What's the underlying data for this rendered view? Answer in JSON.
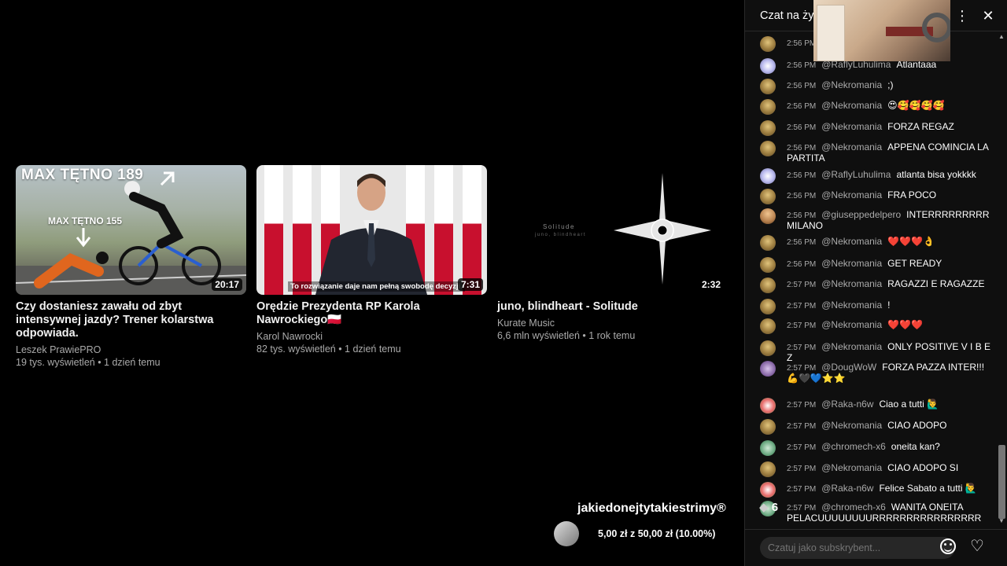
{
  "videos": [
    {
      "title": "Czy dostaniesz zawału od zbyt intensywnej jazdy? Trener kolarstwa odpowiada.",
      "channel": "Leszek PrawiePRO",
      "stats": "19 tys. wyświetleń • 1 dzień temu",
      "duration": "20:17",
      "thumb_text_big": "MAX TĘTNO 189",
      "thumb_text_small": "MAX TĘTNO 155"
    },
    {
      "title": "Orędzie Prezydenta RP Karola Nawrockiego🇵🇱",
      "channel": "Karol Nawrocki",
      "stats": "82 tys. wyświetleń • 1 dzień temu",
      "duration": "7:31",
      "thumb_caption": "To rozwiązanie daje nam pełną swobodę decyzji."
    },
    {
      "title": "juno, blindheart - Solitude",
      "channel": "Kurate Music",
      "stats": "6,6 mln wyświetleń • 1 rok temu",
      "duration": "2:32",
      "thumb_text": "Solitude",
      "thumb_subtext": "juno, blindheart"
    }
  ],
  "overlay": {
    "channel_name": "jakiedonejtytakiestrimy®",
    "progress_text": "5,00 zł z 50,00 zł (10.00%)",
    "badge_text": "6"
  },
  "chat": {
    "title": "Czat na żyw",
    "input_placeholder": "Czatuj jako subskrybent...",
    "messages": [
      {
        "time": "2:56 PM",
        "author": "",
        "text": "",
        "avatar": "nek"
      },
      {
        "time": "2:56 PM",
        "author": "@RaflyLuhulima",
        "text": "Atlantaaa",
        "avatar": "raf"
      },
      {
        "time": "2:56 PM",
        "author": "@Nekromania",
        "text": ";)",
        "avatar": "nek"
      },
      {
        "time": "2:56 PM",
        "author": "@Nekromania",
        "text": "😍🥰🥰🥰🥰",
        "avatar": "nek"
      },
      {
        "time": "2:56 PM",
        "author": "@Nekromania",
        "text": "FORZA REGAZ",
        "avatar": "nek"
      },
      {
        "time": "2:56 PM",
        "author": "@Nekromania",
        "text": "APPENA COMINCIA LA PARTITA",
        "avatar": "nek"
      },
      {
        "time": "2:56 PM",
        "author": "@RaflyLuhulima",
        "text": "atlanta bisa yokkkk",
        "avatar": "raf"
      },
      {
        "time": "2:56 PM",
        "author": "@Nekromania",
        "text": "FRA POCO",
        "avatar": "nek"
      },
      {
        "time": "2:56 PM",
        "author": "@giuseppedelpero",
        "text": "INTERRRRRRRRR MILANO",
        "avatar": "giu"
      },
      {
        "time": "2:56 PM",
        "author": "@Nekromania",
        "text": "❤️❤️❤️👌",
        "avatar": "nek"
      },
      {
        "time": "2:56 PM",
        "author": "@Nekromania",
        "text": "GET READY",
        "avatar": "nek"
      },
      {
        "time": "2:57 PM",
        "author": "@Nekromania",
        "text": "RAGAZZI E RAGAZZE",
        "avatar": "nek"
      },
      {
        "time": "2:57 PM",
        "author": "@Nekromania",
        "text": "!",
        "avatar": "nek"
      },
      {
        "time": "2:57 PM",
        "author": "@Nekromania",
        "text": "❤️❤️❤️",
        "avatar": "nek"
      },
      {
        "time": "2:57 PM",
        "author": "@Nekromania",
        "text": "ONLY POSITIVE V I B E Z",
        "avatar": "nek"
      },
      {
        "time": "2:57 PM",
        "author": "@DougWoW",
        "text": "FORZA PAZZA INTER!!! 💪🖤💙⭐⭐",
        "avatar": "dou"
      },
      {
        "time": "2:57 PM",
        "author": "@Raka-n6w",
        "text": "Ciao a tutti 🙋‍♂️",
        "avatar": "rak"
      },
      {
        "time": "2:57 PM",
        "author": "@Nekromania",
        "text": "CIAO ADOPO",
        "avatar": "nek"
      },
      {
        "time": "2:57 PM",
        "author": "@chromech-x6",
        "text": "oneita kan?",
        "avatar": "chr"
      },
      {
        "time": "2:57 PM",
        "author": "@Nekromania",
        "text": "CIAO ADOPO SI",
        "avatar": "nek"
      },
      {
        "time": "2:57 PM",
        "author": "@Raka-n6w",
        "text": "Felice Sabato a tutti 🙋‍♂️",
        "avatar": "rak"
      },
      {
        "time": "2:57 PM",
        "author": "@chromech-x6",
        "text": "WANITA ONEITA PELACUUUUUUUURRRRRRRRRRRRRRRR",
        "avatar": "chr"
      }
    ]
  }
}
